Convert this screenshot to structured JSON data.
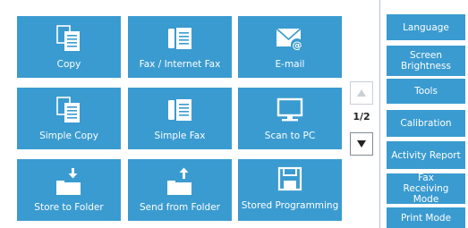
{
  "main": {
    "tiles": [
      {
        "label": "Copy",
        "icon": "copy-icon"
      },
      {
        "label": "Fax / Internet Fax",
        "icon": "fax-icon"
      },
      {
        "label": "E-mail",
        "icon": "email-icon"
      },
      {
        "label": "Simple Copy",
        "icon": "copy-icon"
      },
      {
        "label": "Simple Fax",
        "icon": "fax-icon"
      },
      {
        "label": "Scan to PC",
        "icon": "pc-monitor-icon"
      },
      {
        "label": "Store to Folder",
        "icon": "store-folder-icon"
      },
      {
        "label": "Send from Folder",
        "icon": "send-folder-icon"
      },
      {
        "label": "Stored Programming",
        "icon": "floppy-disk-icon"
      }
    ]
  },
  "pager": {
    "indicator": "1/2",
    "up_icon": "arrow-up-icon",
    "down_icon": "arrow-down-icon"
  },
  "sidebar": {
    "items": [
      {
        "label": "Language"
      },
      {
        "label": "Screen Brightness"
      },
      {
        "label": "Tools"
      },
      {
        "label": "Calibration"
      },
      {
        "label": "Activity Report"
      },
      {
        "label": "Fax Receiving Mode"
      },
      {
        "label": "Print Mode"
      }
    ]
  },
  "colors": {
    "tile_blue": "#3a9bd0",
    "icon_white": "#ffffff",
    "text_dark": "#222222"
  }
}
